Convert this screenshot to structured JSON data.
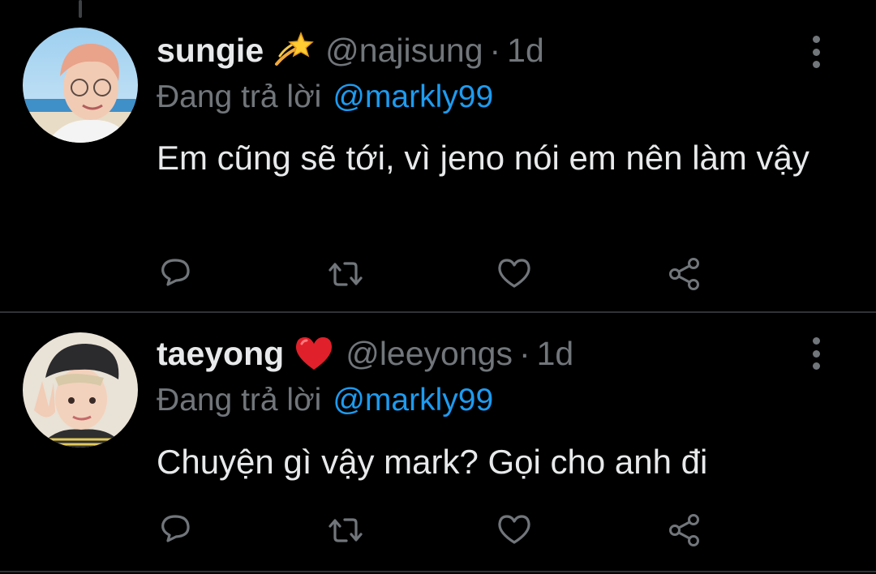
{
  "colors": {
    "background": "#000000",
    "text_primary": "#e7e9ea",
    "text_secondary": "#71767b",
    "link": "#1d9bf0",
    "divider": "#2f3336"
  },
  "tweets": [
    {
      "display_name": "sungie",
      "emoji": "dizzy-star-emoji",
      "handle": "@najisung",
      "separator": "·",
      "time": "1d",
      "reply_prefix": "Đang trả lời",
      "reply_to": "@markly99",
      "text": "Em cũng sẽ tới, vì jeno nói em nên làm vậy",
      "avatar": "avatar-photo-beach"
    },
    {
      "display_name": "taeyong",
      "emoji": "red-heart-emoji",
      "handle": "@leeyongs",
      "separator": "·",
      "time": "1d",
      "reply_prefix": "Đang trả lời",
      "reply_to": "@markly99",
      "text": "Chuyện gì vậy mark? Gọi cho anh đi",
      "avatar": "avatar-photo-beret"
    }
  ],
  "actions": [
    "reply-icon",
    "retweet-icon",
    "like-icon",
    "share-icon"
  ]
}
